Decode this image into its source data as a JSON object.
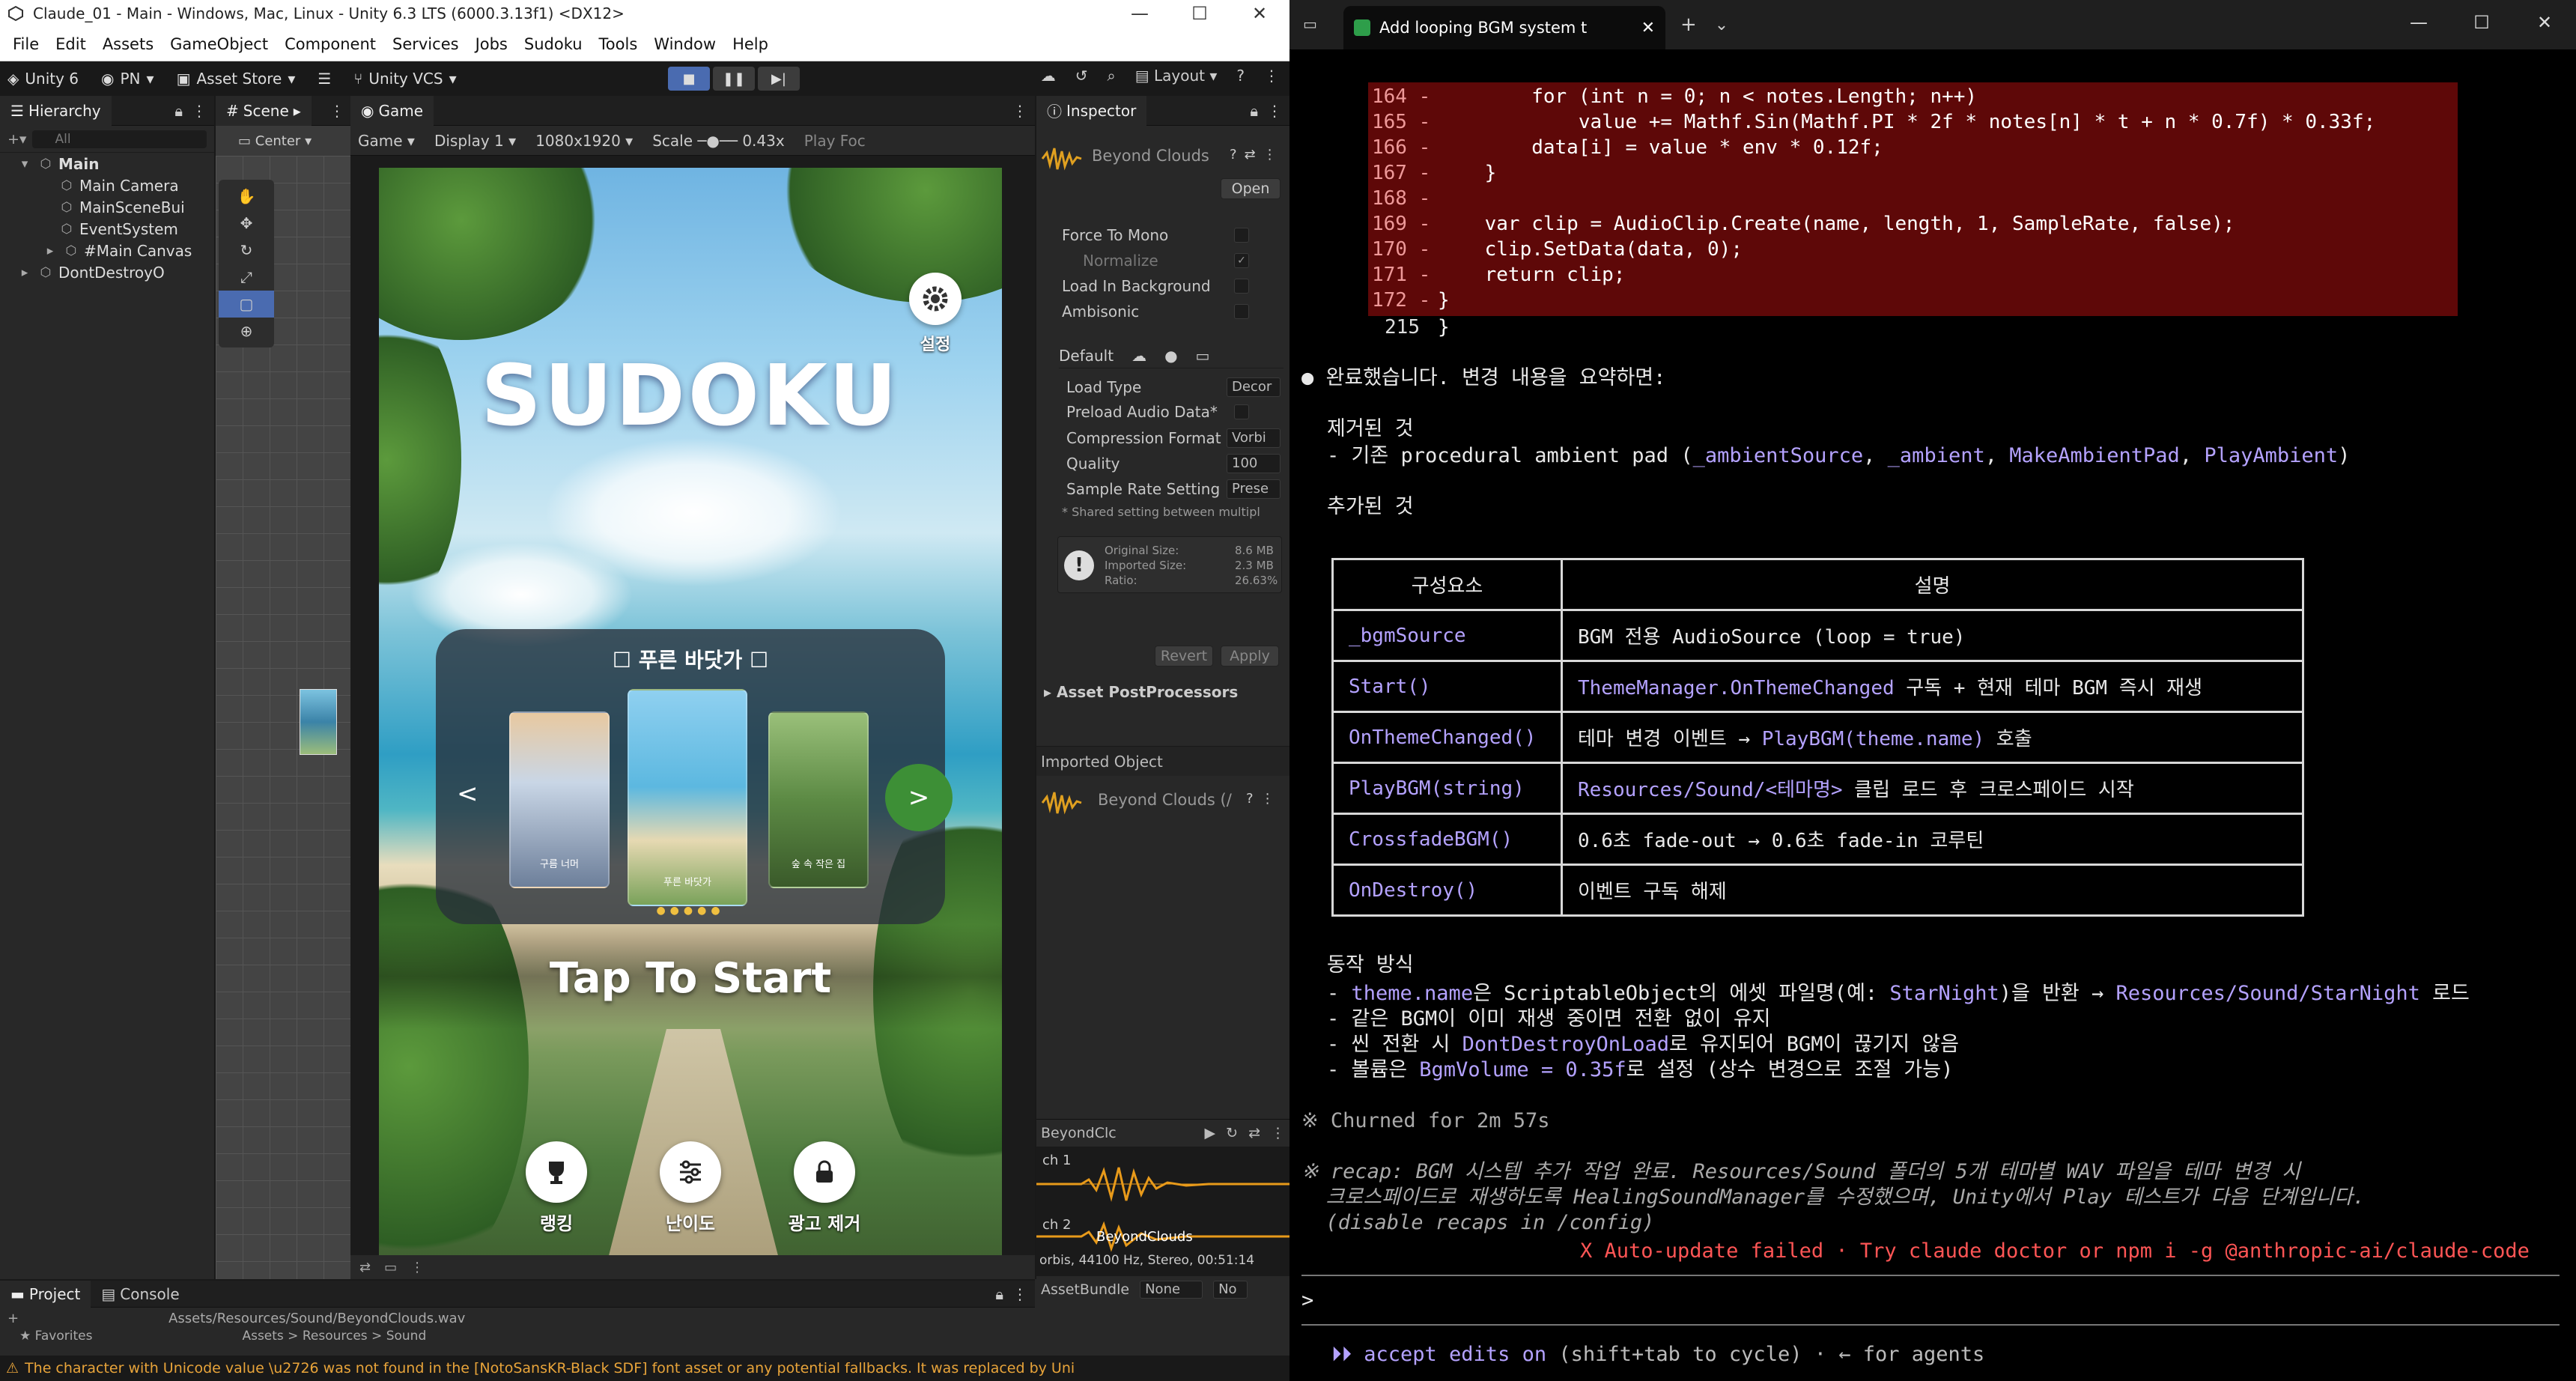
{
  "unity": {
    "title": "Claude_01 - Main - Windows, Mac, Linux - Unity 6.3 LTS (6000.3.13f1) <DX12>",
    "menu": [
      "File",
      "Edit",
      "Assets",
      "GameObject",
      "Component",
      "Services",
      "Jobs",
      "Sudoku",
      "Tools",
      "Window",
      "Help"
    ],
    "toolbar": {
      "account": "Unity 6",
      "user": "PN",
      "asset_store": "Asset Store",
      "vcs": "Unity VCS",
      "layout": "Layout"
    },
    "hierarchy": {
      "tab": "Hierarchy",
      "search_placeholder": "All",
      "items": [
        {
          "label": "Main",
          "depth": 0
        },
        {
          "label": "Main Camera",
          "depth": 1
        },
        {
          "label": "MainSceneBui",
          "depth": 1
        },
        {
          "label": "EventSystem",
          "depth": 1
        },
        {
          "label": "#Main Canvas",
          "depth": 1
        },
        {
          "label": "DontDestroyO",
          "depth": 0
        }
      ]
    },
    "scene_tab": "Scene",
    "game": {
      "tab": "Game",
      "pivot": "Center",
      "mode": "Game",
      "display": "Display 1",
      "resolution": "1080x1920",
      "scale_label": "Scale",
      "scale_value": "0.43x",
      "play_focus": "Play Foc",
      "title": "SUDOKU",
      "settings_label": "설정",
      "theme_name": "푸른 바닷가",
      "thumbs": [
        "구름 너머",
        "푸른 바닷가",
        "숲 속 작은 집"
      ],
      "tap_to_start": "Tap To Start",
      "buttons": [
        {
          "label": "랭킹",
          "icon": "trophy-icon"
        },
        {
          "label": "난이도",
          "icon": "sliders-icon"
        },
        {
          "label": "광고 제거",
          "icon": "lock-icon"
        }
      ]
    },
    "inspector": {
      "tab": "Inspector",
      "asset_name": "Beyond Clouds",
      "open_btn": "Open",
      "force_to_mono": "Force To Mono",
      "normalize": "Normalize",
      "load_in_background": "Load In Background",
      "ambisonic": "Ambisonic",
      "default_tab": "Default",
      "load_type": {
        "label": "Load Type",
        "value": "Decor"
      },
      "preload_audio": "Preload Audio Data*",
      "compression": {
        "label": "Compression Format",
        "value": "Vorbi"
      },
      "quality": {
        "label": "Quality",
        "value": "100"
      },
      "sample_rate": {
        "label": "Sample Rate Setting",
        "value": "Prese"
      },
      "shared_note": "* Shared setting between multipl",
      "original_size": {
        "label": "Original Size:",
        "value": "8.6 MB"
      },
      "imported_size": {
        "label": "Imported Size:",
        "value": "2.3 MB"
      },
      "ratio": {
        "label": "Ratio:",
        "value": "26.63%"
      },
      "revert": "Revert",
      "apply": "Apply",
      "post_processors": "Asset PostProcessors",
      "imported_object": "Imported Object",
      "imported_name": "Beyond Clouds (/",
      "preview_name": "BeyondClc",
      "ch1": "ch 1",
      "ch2": "ch 2",
      "clip_overlay": "BeyondClouds",
      "clip_info": "orbis, 44100 Hz, Stereo, 00:51:14",
      "asset_bundle": {
        "label": "AssetBundle",
        "value": "None",
        "variant": "No"
      }
    },
    "bottom": {
      "tabs": [
        "Project",
        "Console"
      ],
      "favorites": "Favorites",
      "path": "Assets/Resources/Sound/BeyondClouds.wav",
      "breadcrumb": "Assets > Resources > Sound"
    },
    "status_message": "The character with Unicode value \\u2726 was not found in the [NotoSansKR-Black SDF] font asset or any potential fallbacks. It was replaced by Uni"
  },
  "terminal": {
    "tab_title": "Add looping BGM system t",
    "diff_lines": [
      {
        "num": "164 -",
        "code": "        for (int n = 0; n < notes.Length; n++)"
      },
      {
        "num": "165 -",
        "code": "            value += Mathf.Sin(Mathf.PI * 2f * notes[n] * t + n * 0.7f) * 0.33f;"
      },
      {
        "num": "166 -",
        "code": "        data[i] = value * env * 0.12f;"
      },
      {
        "num": "167 -",
        "code": "    }"
      },
      {
        "num": "168 -",
        "code": ""
      },
      {
        "num": "169 -",
        "code": "    var clip = AudioClip.Create(name, length, 1, SampleRate, false);"
      },
      {
        "num": "170 -",
        "code": "    clip.SetData(data, 0);"
      },
      {
        "num": "171 -",
        "code": "    return clip;"
      },
      {
        "num": "172 -",
        "code": "}"
      },
      {
        "num": "215",
        "code": "}"
      }
    ],
    "done_msg": "완료했습니다. 변경 내용을 요약하면:",
    "removed_heading": "제거된 것",
    "removed_prefix": "- 기존 procedural ambient pad (",
    "removed_items": [
      "_ambientSource",
      ", ",
      "_ambient",
      ", ",
      "MakeAmbientPad",
      ", ",
      "PlayAmbient",
      ")"
    ],
    "added_heading": "추가된 것",
    "table_header": [
      "구성요소",
      "설명"
    ],
    "table_rows": [
      {
        "c1": "_bgmSource",
        "c2a": "",
        "c2b": "BGM 전용 AudioSource (loop = true)"
      },
      {
        "c1": "Start()",
        "c2a": "ThemeManager.OnThemeChanged",
        "c2b": " 구독 + 현재 테마 BGM 즉시 재생"
      },
      {
        "c1": "OnThemeChanged()",
        "c2a": "",
        "c2b": "테마 변경 이벤트 → ",
        "c2c": "PlayBGM(theme.name)",
        "c2d": " 호출"
      },
      {
        "c1": "PlayBGM(string)",
        "c2a": "Resources/Sound/<테마명>",
        "c2b": " 클립 로드 후 크로스페이드 시작"
      },
      {
        "c1": "CrossfadeBGM()",
        "c2a": "",
        "c2b": "0.6초 fade-out → 0.6초 fade-in 코루틴"
      },
      {
        "c1": "OnDestroy()",
        "c2a": "",
        "c2b": "이벤트 구독 해제"
      }
    ],
    "behavior_heading": "동작 방식",
    "behavior": [
      {
        "a": "- ",
        "b": "theme.name",
        "c": "은 ScriptableObject의 에셋 파일명(예: ",
        "d": "StarNight",
        "e": ")을 반환 → ",
        "f": "Resources/Sound/StarNight",
        "g": " 로드"
      },
      {
        "a": "- 같은 BGM이 이미 재생 중이면 전환 없이 유지"
      },
      {
        "a": "- 씬 전환 시 ",
        "b": "DontDestroyOnLoad",
        "c": "로 유지되어 BGM이 끊기지 않음"
      },
      {
        "a": "- 볼륨은 ",
        "b": "BgmVolume = 0.35f",
        "c": "로 설정 (상수 변경으로 조절 가능)"
      }
    ],
    "churned": "※ Churned for 2m 57s",
    "recap1": "※ recap: BGM 시스템 추가 작업 완료. Resources/Sound 폴더의 5개 테마별 WAV 파일을 테마 변경 시",
    "recap2": "  크로스페이드로 재생하도록 HealingSoundManager를 수정했으며, Unity에서 Play 테스트가 다음 단계입니다.",
    "recap3": "  (disable recaps in /config)",
    "error": "X Auto-update failed · Try claude doctor or npm i -g @anthropic-ai/claude-code",
    "prompt": ">",
    "footer_mode": "⏵⏵ accept edits on",
    "footer_rest": " (shift+tab to cycle) · ← for agents"
  },
  "colors": {
    "accent": "#b4a2ff",
    "diff_bg": "#5e0808",
    "unity_bg": "#282828",
    "green_button": "#3d8f36"
  }
}
